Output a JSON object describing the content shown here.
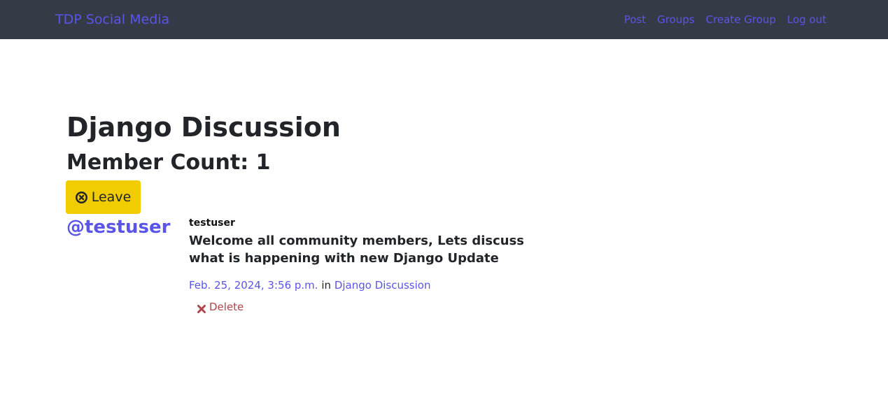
{
  "navbar": {
    "brand": "TDP Social Media",
    "links": [
      {
        "label": "Post"
      },
      {
        "label": "Groups"
      },
      {
        "label": "Create Group"
      },
      {
        "label": "Log out"
      }
    ]
  },
  "group": {
    "title": "Django Discussion",
    "member_count": "Member Count: 1",
    "leave_label": "Leave",
    "leave_icon": "times-circle-icon"
  },
  "post": {
    "handle": "@testuser",
    "author": "testuser",
    "message": "Welcome all community members, Lets discuss what is happening with new Django Update",
    "timestamp": "Feb. 25, 2024, 3:56 p.m.",
    "in_word": "in",
    "group_link": "Django Discussion",
    "delete_label": "Delete",
    "delete_icon": "times-icon"
  },
  "colors": {
    "navbar_bg": "#343a46",
    "link": "#5a55e8",
    "leave_button": "#f0cc00",
    "delete": "#b0454a"
  }
}
